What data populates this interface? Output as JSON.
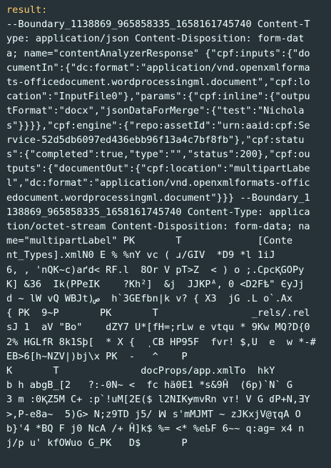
{
  "output": {
    "key_label": "result:",
    "lines": [
      "--Boundary_1138869_965858335_1658161745740 Content-T",
      "ype: application/json Content-Disposition: form-dat",
      "a; name=\"contentAnalyzerResponse\" {\"cpf:inputs\":{\"do",
      "cumentIn\":{\"dc:format\":\"application/vnd.openxmlforma",
      "ts-officedocument.wordprocessingml.document\",\"cpf:lo",
      "cation\":\"InputFile0\"},\"params\":{\"cpf:inline\":{\"outpu",
      "tFormat\":\"docx\",\"jsonDataForMerge\":{\"test\":\"Nichola",
      "s\"}}}},\"cpf:engine\":{\"repo:assetId\":\"urn:aaid:cpf:Se",
      "rvice-52d5db6097ed436ebb96f13a4c7bf8fb\"},\"cpf:statu",
      "s\":{\"completed\":true,\"type\":\"\",\"status\":200},\"cpf:ou",
      "tputs\":{\"documentOut\":{\"cpf:location\":\"multipartLabe",
      "l\",\"dc:format\":\"application/vnd.openxmlformats-offic",
      "edocument.wordprocessingml.document\"}}} --Boundary_1",
      "138869_965858335_1658161745740 Content-Type: applica",
      "tion/octet-stream Content-Disposition: form-data; na",
      "me=\"multipartLabel\" PK       T             [Conte",
      "nt_Types].xmlN0 E % %nY vc ( ɹ/GIV  *D9 *l 1iJ",
      "6, , 'nQK~c)aґd< RF.l  8Or V pT>Z  < ) o ;.CpcⱩGOPy",
      "K] &36  Ik(PPeIK    ?Kh²]  &j  JJKPᴬ, 0 <D2Fѣ\" ЄyJj",
      "ԁ ~ lW vQ WBJt)ﺹ  h`3GEfbn|k v? { X3  jG .L o`.Ax",
      "{ PK  9~P       PK       T                _rels/.rel",
      "sJ 1  aV \"Bo\"    dZY7 U*[fH=;rLw e vtqu * 9Kw MQ?D{0",
      "2% HGLfR 8k1Sþ[  * X {  ͺCB HP95F  fvr! $,U  e  w *-#",
      "EB>6[h~NZV|)bj\\x PK  -   ^    P",
      "K       T              docProps/app.xmlTo  hkY",
      "b h abgB_[2   ?:-0N~ <  fc hä0E1 *s&9Ĥ  (6p)`N` G",
      "3 m :0ⱩZ5M C+ :p`!uM[2E($ l2NIKɏmvRn vт! V G ɗP+N,ƎY",
      ">,P-e8a~  5)G> N;z9TD j5/ ꟽ s'mMJMT ~ zJKxjV@ҭqA O",
      "b}'4 *BQ F j0 NcA /+ Ĥ]k$ %= <* %eҍF 6~~ q:ag= x4 n",
      "j/p u' kfOWuo G_PK   D$       P"
    ]
  },
  "colors": {
    "background": "#263238",
    "key": "#ffcb6b",
    "text": "#eeffff"
  }
}
